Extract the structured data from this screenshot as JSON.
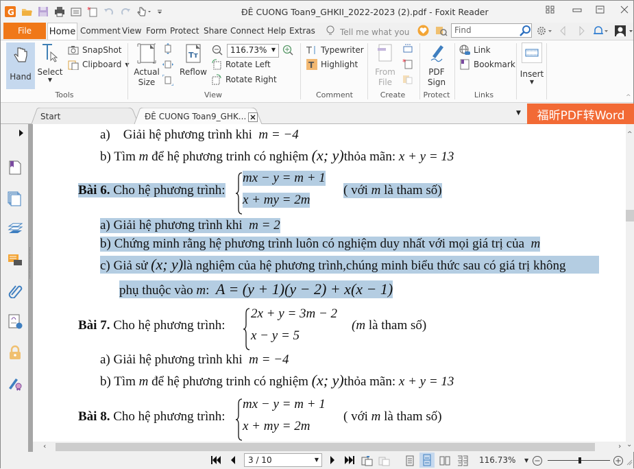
{
  "window": {
    "title": "ĐÊ CUONG Toan9_GHKII_2022-2023  (2).pdf - Foxit Reader"
  },
  "quick_access": [
    "foxit-logo-icon",
    "open-folder-icon",
    "save-icon",
    "print-icon",
    "scan-icon",
    "new-icon",
    "undo-icon",
    "redo-icon",
    "hand-tool-icon",
    "customize-icon"
  ],
  "menu": {
    "file": "File",
    "tabs": [
      "Home",
      "Comment",
      "View",
      "Form",
      "Protect",
      "Share",
      "Connect",
      "Help",
      "Extras"
    ],
    "active_tab": "Home",
    "tell_me_placeholder": "Tell me what you w",
    "find_placeholder": "Find"
  },
  "ribbon": {
    "tools": {
      "label": "Tools",
      "hand": "Hand",
      "select": "Select",
      "snapshot": "SnapShot",
      "clipboard": "Clipboard"
    },
    "view": {
      "label": "View",
      "actual_size": "Actual Size",
      "actual_size_line1": "Actual",
      "actual_size_line2": "Size",
      "reflow": "Reflow",
      "zoom_value": "116.73%",
      "rotate_left": "Rotate Left",
      "rotate_right": "Rotate Right"
    },
    "comment": {
      "label": "Comment",
      "typewriter": "Typewriter",
      "highlight": "Highlight"
    },
    "create": {
      "label": "Create",
      "from_file_line1": "From",
      "from_file_line2": "File"
    },
    "protect": {
      "label": "Protect",
      "pdf_sign_line1": "PDF",
      "pdf_sign_line2": "Sign"
    },
    "links": {
      "label": "Links",
      "link": "Link",
      "bookmark": "Bookmark"
    },
    "insert": {
      "label": "Insert"
    }
  },
  "doc_tabs": {
    "start": "Start",
    "current": "ĐÊ CUONG Toan9_GHK...",
    "convert_button": "福昕PDF转Word"
  },
  "left_panel": [
    "bookmark-panel-icon",
    "pages-panel-icon",
    "layers-panel-icon",
    "comments-panel-icon",
    "attachments-panel-icon",
    "signature-panel-icon",
    "security-panel-icon",
    "digital-sign-panel-icon"
  ],
  "document": {
    "lines": {
      "l1_label": "a)",
      "l1_text": "Giải hệ phương trình khi",
      "l1_math": "m = −4",
      "l2_text": "b) Tìm",
      "l2_m": "m",
      "l2_text2": "để hệ phương trinh có nghiệm",
      "l2_math": "(x; y)",
      "l2_text3": "thỏa mãn:",
      "l2_math2": "x + y = 13",
      "bai6_title": "Bài 6.",
      "bai6_text": "Cho hệ phương trình:",
      "bai6_eq1": "mx − y = m + 1",
      "bai6_eq2": "x + my = 2m",
      "bai6_note": "( với",
      "bai6_note_m": "m",
      "bai6_note2": "là tham số)",
      "b6a_text": "a)  Giải hệ phương trình khi",
      "b6a_math": "m = 2",
      "b6b_text": "b)  Chứng minh rằng hệ phương trình luôn có nghiệm duy nhất với mọi giá trị của",
      "b6b_math": "m",
      "b6c_text1": "c)  Giả sử",
      "b6c_math": "(x; y)",
      "b6c_text2": "là nghiệm của hệ phương trình,chúng minh biểu thức sau có giá trị không",
      "b6c2_text": "phụ thuộc vào",
      "b6c2_m": "m",
      "b6c2_colon": ":",
      "b6c2_math": "A = (y + 1)(y − 2) + x(x − 1)",
      "bai7_title": "Bài 7.",
      "bai7_text": "Cho hệ phương trình:",
      "bai7_eq1": "2x + y = 3m − 2",
      "bai7_eq2": "x − y = 5",
      "bai7_note_m": "(m",
      "bai7_note": "là tham số)",
      "b7a_text": "a) Giải hệ phương trình khi",
      "b7a_math": "m = −4",
      "b7b_text": "b) Tìm",
      "b7b_m": "m",
      "b7b_text2": "để hệ phương trinh có nghiệm",
      "b7b_math": "(x; y)",
      "b7b_text3": "thỏa mãn:",
      "b7b_math2": "x + y = 13",
      "bai8_title": "Bài 8.",
      "bai8_text": "Cho hệ phương trình:",
      "bai8_eq1": "mx − y = m + 1",
      "bai8_eq2": "x + my = 2m",
      "bai8_note": "( với",
      "bai8_note_m": "m",
      "bai8_note2": "là tham số)"
    }
  },
  "status": {
    "page_display": "3 / 10",
    "current_page": 3,
    "total_pages": 10,
    "zoom": "116.73%",
    "zoom_slider_fraction": 0.52
  },
  "colors": {
    "file_tab": "#f07818",
    "convert_button": "#f26a35",
    "selection_highlight": "#b4cde2",
    "active_tool": "#c5d8ee"
  }
}
